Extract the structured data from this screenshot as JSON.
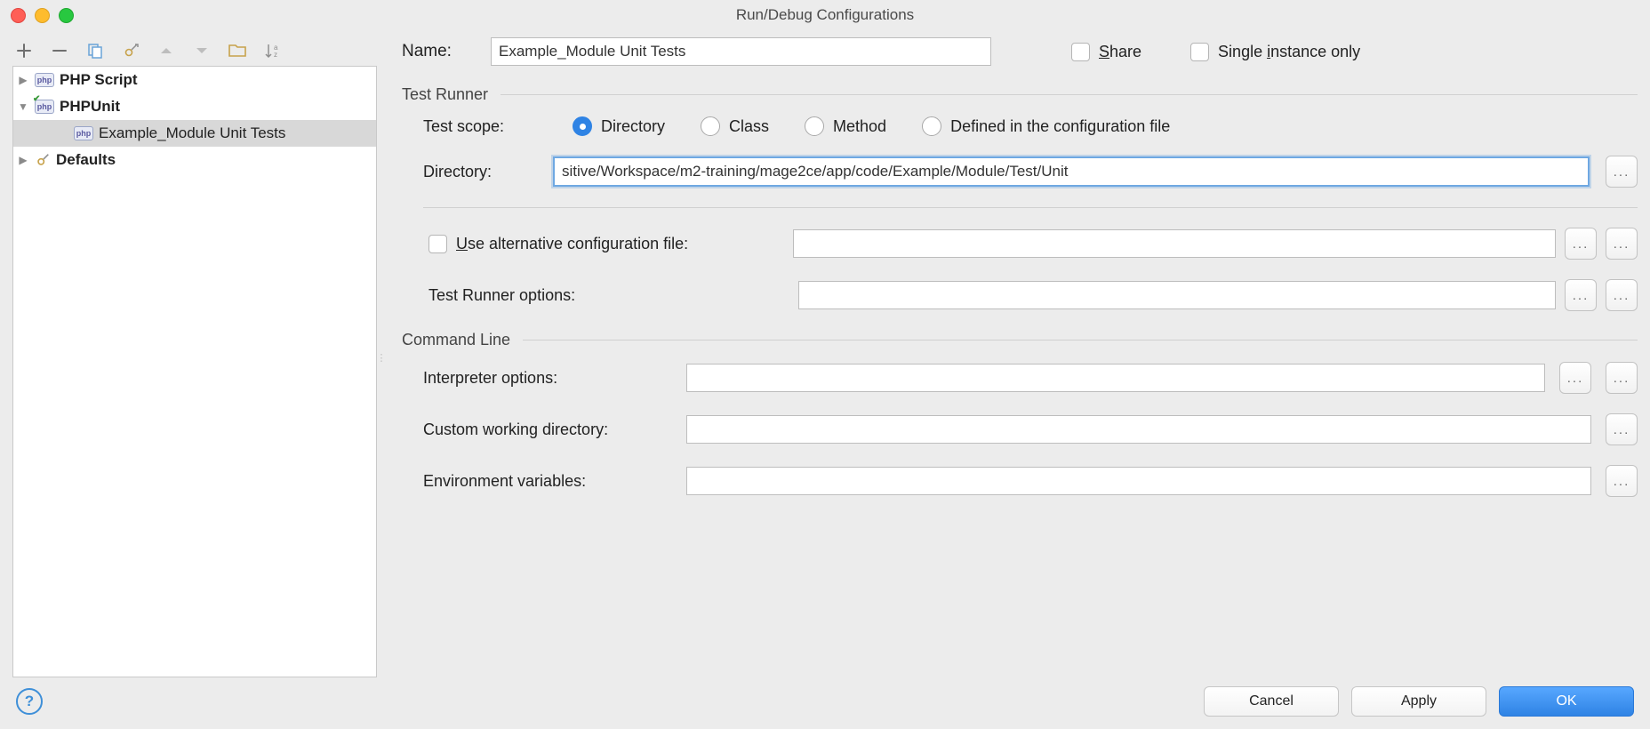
{
  "window": {
    "title": "Run/Debug Configurations"
  },
  "tree": {
    "php_script": "PHP Script",
    "phpunit": "PHPUnit",
    "example_conf": "Example_Module Unit Tests",
    "defaults": "Defaults"
  },
  "form": {
    "name_label": "Name:",
    "name_value": "Example_Module Unit Tests",
    "share_label": "hare",
    "share_prefix": "S",
    "single_instance_pre": "Single ",
    "single_instance_u": "i",
    "single_instance_post": "nstance only",
    "testrunner_title": "Test Runner",
    "scope_label": "Test scope:",
    "scope_options": {
      "directory": "Directory",
      "class": "Class",
      "method": "Method",
      "defined": "Defined in the configuration file"
    },
    "directory_label": "Directory:",
    "directory_value": "sitive/Workspace/m2-training/mage2ce/app/code/Example/Module/Test/Unit",
    "use_alt_pre": "U",
    "use_alt_post": "se alternative configuration file:",
    "alt_value": "",
    "runner_options_label": "Test Runner options:",
    "runner_options_value": "",
    "cmd_title": "Command Line",
    "interpreter_label": "Interpreter options:",
    "interpreter_value": "",
    "cwd_label": "Custom working directory:",
    "cwd_value": "",
    "env_label": "Environment variables:",
    "env_value": ""
  },
  "buttons": {
    "cancel": "Cancel",
    "apply": "Apply",
    "ok": "OK"
  }
}
